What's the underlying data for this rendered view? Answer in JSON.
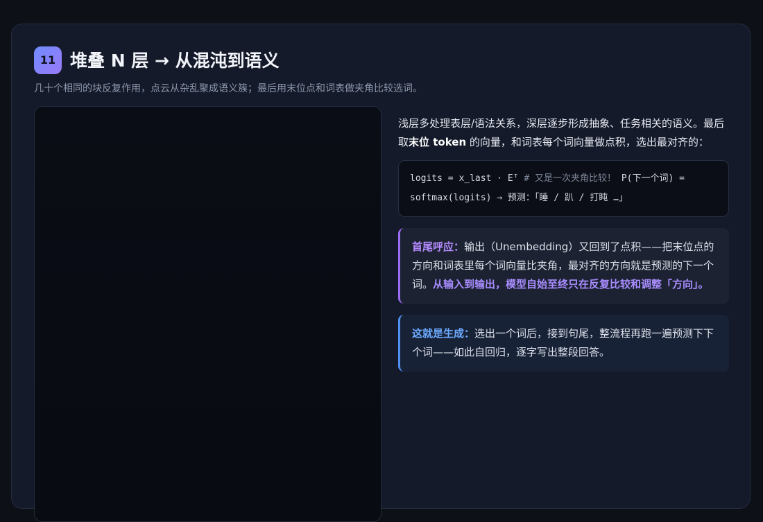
{
  "header": {
    "step_number": "11",
    "title": "堆叠 N 层 → 从混沌到语义",
    "subtitle": "几十个相同的块反复作用，点云从杂乱聚成语义簇；最后用末位点和词表做夹角比较选词。"
  },
  "intro": {
    "text_before": "浅层多处理表层/语法关系，深层逐步形成抽象、任务相关的语义。最后取",
    "strong": "末位 token",
    "text_after": " 的向量，和词表每个词向量做点积，选出最对齐的："
  },
  "code": {
    "line1_code": "logits = x_last · Eᵀ ",
    "line1_comment": "# 又是一次夹角比较！",
    "line1_tail": " P(下一个词) =",
    "line2": "softmax(logits) → 预测：「睡 / 趴 / 打盹 …」"
  },
  "callout_echo": {
    "lead": "首尾呼应：",
    "text": "输出（Unembedding）又回到了点积——把末位点的方向和词表里每个词向量比夹角，最对齐的方向就是预测的下一个词。",
    "emphasis": "从输入到输出，模型自始至终只在反复比较和调整「方向」。"
  },
  "callout_generation": {
    "lead": "这就是生成：",
    "text": "选出一个词后，接到句尾，整流程再跑一遍预测下下个词——如此自回归，逐字写出整段回答。"
  },
  "colors": {
    "accent_purple": "#9a6cf2",
    "accent_blue": "#4e8fef",
    "background": "#141a29"
  }
}
